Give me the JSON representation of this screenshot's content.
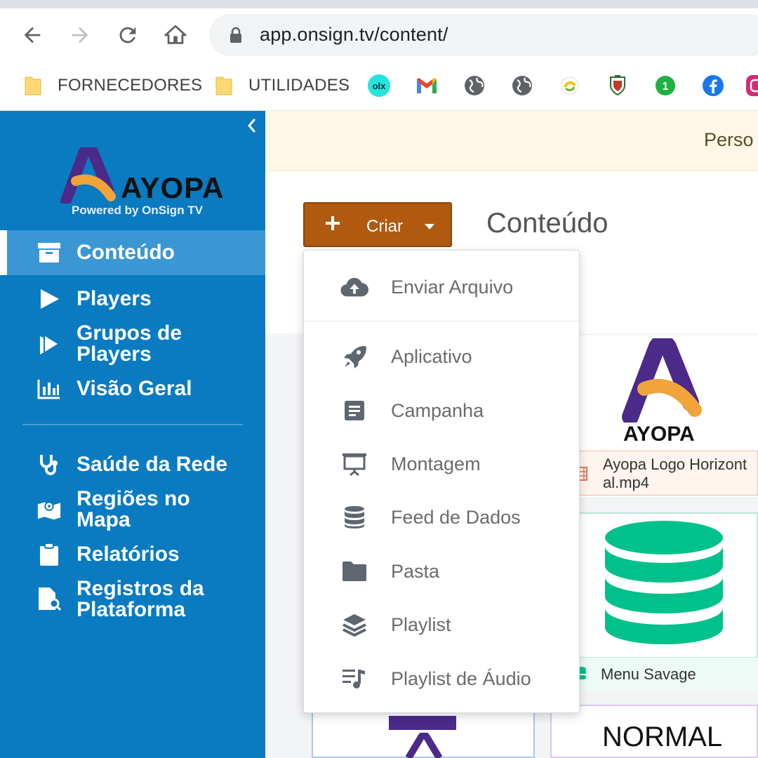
{
  "browser": {
    "url": "app.onsign.tv/content/",
    "bookmarks": [
      {
        "label": "FORNECEDORES",
        "icon": "folder-icon"
      },
      {
        "label": "UTILIDADES",
        "icon": "folder-icon"
      }
    ],
    "bookmark_icons": [
      "olx-icon",
      "gmail-icon",
      "globe-icon",
      "globe-icon",
      "sicredi-icon",
      "crest-icon",
      "whatsapp-icon",
      "facebook-icon",
      "instagram-icon"
    ]
  },
  "sidebar": {
    "logo_text": "AYOPA",
    "powered_by": "Powered by OnSign TV",
    "items": [
      {
        "label": "Conteúdo",
        "icon": "archive-icon",
        "active": true
      },
      {
        "label": "Players",
        "icon": "play-icon"
      },
      {
        "label": "Grupos de Players",
        "line1": "Grupos de",
        "line2": "Players",
        "icon": "play-group-icon"
      },
      {
        "label": "Visão Geral",
        "icon": "bar-chart-icon"
      },
      {
        "label": "Saúde da Rede",
        "icon": "stethoscope-icon"
      },
      {
        "label": "Regiões no Mapa",
        "line1": "Regiões no",
        "line2": "Mapa",
        "icon": "map-icon"
      },
      {
        "label": "Relatórios",
        "icon": "clipboard-icon"
      },
      {
        "label": "Registros da Plataforma",
        "line1": "Registros da",
        "line2": "Plataforma",
        "icon": "file-search-icon"
      }
    ]
  },
  "banner": {
    "text": "Perso"
  },
  "main": {
    "title": "Conteúdo",
    "create_button": "Criar"
  },
  "dropdown": {
    "items": [
      {
        "label": "Enviar Arquivo",
        "icon": "cloud-upload-icon"
      },
      {
        "label": "Aplicativo",
        "icon": "rocket-icon"
      },
      {
        "label": "Campanha",
        "icon": "document-icon"
      },
      {
        "label": "Montagem",
        "icon": "presentation-icon"
      },
      {
        "label": "Feed de Dados",
        "icon": "database-icon"
      },
      {
        "label": "Pasta",
        "icon": "folder-icon"
      },
      {
        "label": "Playlist",
        "icon": "layers-icon"
      },
      {
        "label": "Playlist de Áudio",
        "icon": "audio-playlist-icon"
      }
    ]
  },
  "cards": [
    {
      "caption_line1": "Ayopa Logo Horizont",
      "caption_line2": "al.mp4",
      "logo_text": "AYOPA"
    },
    {
      "caption": "Menu Savage"
    },
    {
      "text": "NORMAL"
    }
  ],
  "colors": {
    "sidebar": "#0a7bc1",
    "sidebar_active": "#3a97d4",
    "create_button": "#b05a10",
    "database_green": "#00c08b",
    "banner_bg": "#fff8e6"
  }
}
